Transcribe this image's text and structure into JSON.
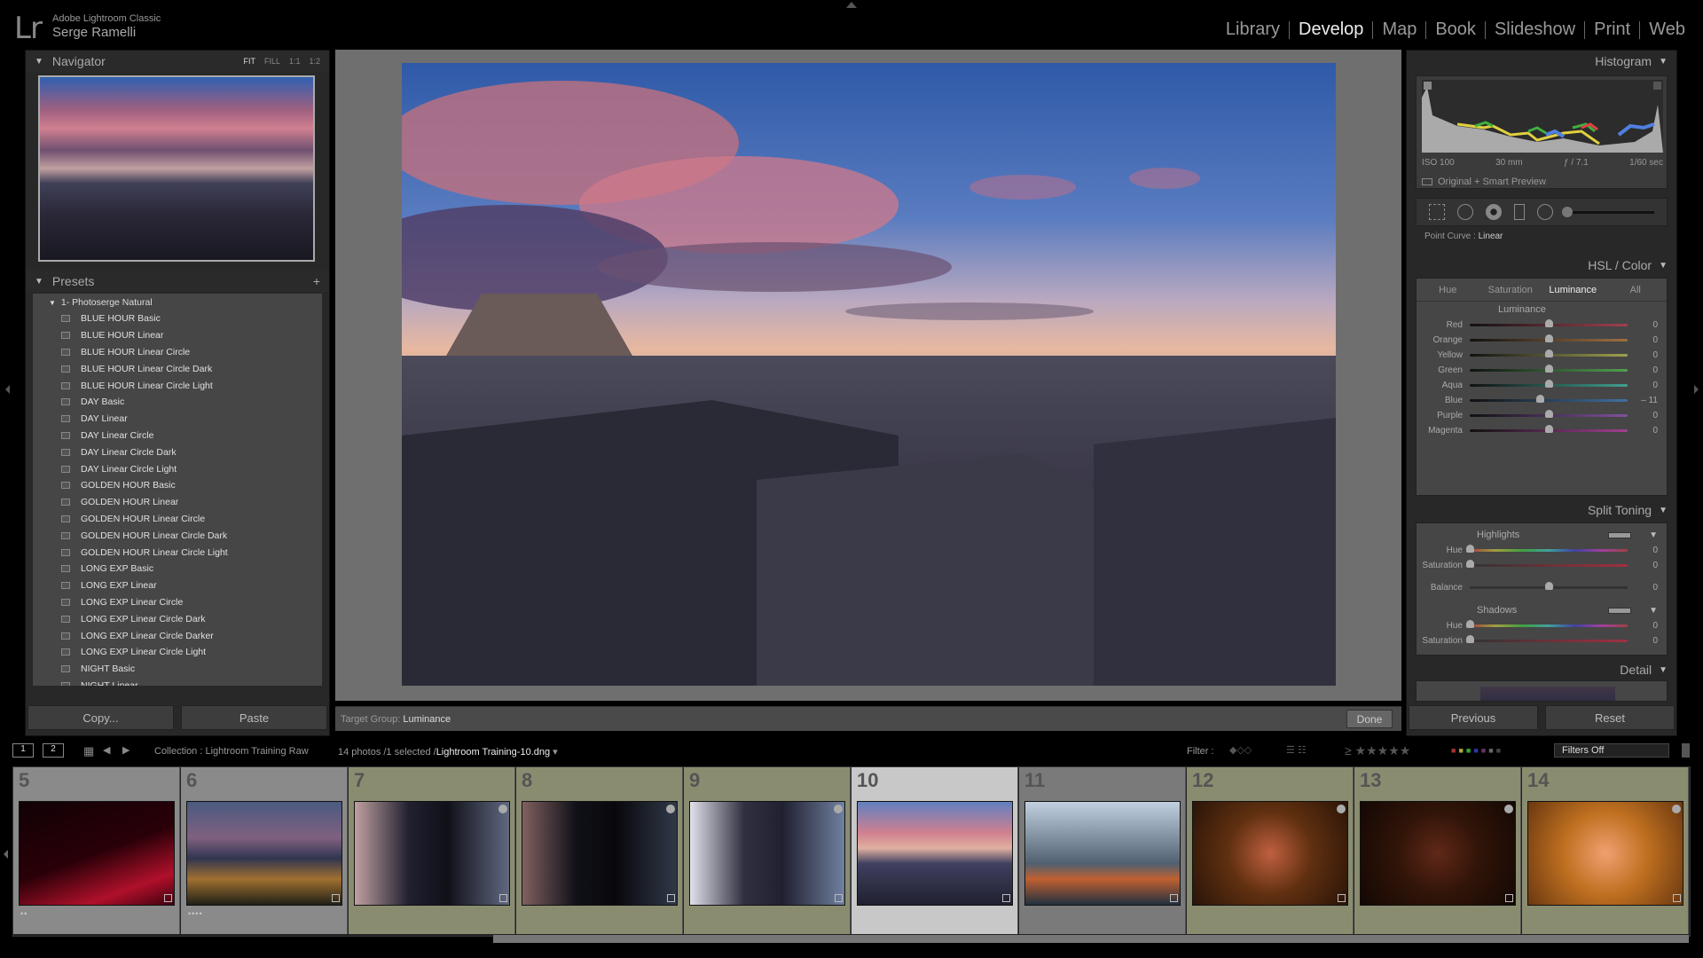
{
  "app": {
    "logo": "Lr",
    "name": "Adobe Lightroom Classic",
    "user": "Serge Ramelli"
  },
  "modules": [
    {
      "label": "Library",
      "active": false
    },
    {
      "label": "Develop",
      "active": true
    },
    {
      "label": "Map",
      "active": false
    },
    {
      "label": "Book",
      "active": false
    },
    {
      "label": "Slideshow",
      "active": false
    },
    {
      "label": "Print",
      "active": false
    },
    {
      "label": "Web",
      "active": false
    }
  ],
  "navigator": {
    "title": "Navigator",
    "zoom_options": [
      "FIT",
      "FILL",
      "1:1",
      "1:2"
    ],
    "selected_zoom": "FIT"
  },
  "presets": {
    "title": "Presets",
    "add_icon": "+",
    "folder": "1- Photoserge Natural",
    "items": [
      "BLUE HOUR Basic",
      "BLUE HOUR Linear",
      "BLUE HOUR Linear Circle",
      "BLUE HOUR Linear Circle Dark",
      "BLUE HOUR Linear Circle Light",
      "DAY Basic",
      "DAY Linear",
      "DAY Linear Circle",
      "DAY Linear Circle Dark",
      "DAY Linear Circle Light",
      "GOLDEN HOUR Basic",
      "GOLDEN HOUR Linear",
      "GOLDEN HOUR Linear Circle",
      "GOLDEN HOUR Linear Circle Dark",
      "GOLDEN HOUR Linear Circle Light",
      "LONG EXP Basic",
      "LONG EXP Linear",
      "LONG EXP Linear Circle",
      "LONG EXP Linear Circle Dark",
      "LONG EXP Linear Circle Darker",
      "LONG EXP Linear Circle Light",
      "NIGHT Basic",
      "NIGHT Linear"
    ]
  },
  "left_buttons": {
    "copy": "Copy...",
    "paste": "Paste"
  },
  "toolbar": {
    "target_label": "Target Group:",
    "target_value": "Luminance",
    "done": "Done"
  },
  "histogram": {
    "title": "Histogram",
    "iso": "ISO 100",
    "focal": "30 mm",
    "aperture": "ƒ / 7.1",
    "shutter": "1/60 sec",
    "preview_status": "Original + Smart Preview"
  },
  "point_curve": {
    "label": "Point Curve :",
    "value": "Linear"
  },
  "hsl": {
    "title": "HSL / Color",
    "tabs": [
      {
        "label": "Hue",
        "on": false
      },
      {
        "label": "Saturation",
        "on": false
      },
      {
        "label": "Luminance",
        "on": true
      },
      {
        "label": "All",
        "on": false
      }
    ],
    "group": "Luminance",
    "sliders": [
      {
        "label": "Red",
        "value": "0",
        "pos": 0,
        "color": "#a04050"
      },
      {
        "label": "Orange",
        "value": "0",
        "pos": 0,
        "color": "#a07040"
      },
      {
        "label": "Yellow",
        "value": "0",
        "pos": 0,
        "color": "#a0a050"
      },
      {
        "label": "Green",
        "value": "0",
        "pos": 0,
        "color": "#50a050"
      },
      {
        "label": "Aqua",
        "value": "0",
        "pos": 0,
        "color": "#40a090"
      },
      {
        "label": "Blue",
        "value": "– 11",
        "pos": -11,
        "color": "#4070a0"
      },
      {
        "label": "Purple",
        "value": "0",
        "pos": 0,
        "color": "#8050a0"
      },
      {
        "label": "Magenta",
        "value": "0",
        "pos": 0,
        "color": "#a04090"
      }
    ]
  },
  "split_toning": {
    "title": "Split Toning",
    "highlights": "Highlights",
    "shadows": "Shadows",
    "h_hue": {
      "label": "Hue",
      "value": "0"
    },
    "h_sat": {
      "label": "Saturation",
      "value": "0"
    },
    "balance": {
      "label": "Balance",
      "value": "0"
    },
    "s_hue": {
      "label": "Hue",
      "value": "0"
    },
    "s_sat": {
      "label": "Saturation",
      "value": "0"
    }
  },
  "detail": {
    "title": "Detail"
  },
  "right_buttons": {
    "previous": "Previous",
    "reset": "Reset"
  },
  "filmstrip_bar": {
    "view1": "1",
    "view2": "2",
    "collection": "Collection : Lightroom Training Raw",
    "count": "14 photos /1 selected /",
    "filename": "Lightroom Training-10.dng",
    "filter_label": "Filter :",
    "filters_value": "Filters Off"
  },
  "filmstrip": [
    {
      "num": "5",
      "bg": "#8a8a8a",
      "thumb": "linear-gradient(160deg,#100205 0%,#2a0008 50%,#b0102a 80%,#400010 100%)",
      "flag": false,
      "dots": "••"
    },
    {
      "num": "6",
      "bg": "#8a8a8a",
      "thumb": "linear-gradient(180deg,#4a5a80 0%,#806080 35%,#303550 55%,#a07030 75%,#202018 100%)",
      "flag": false,
      "dots": "••••"
    },
    {
      "num": "7",
      "bg": "#8a8c70",
      "thumb": "linear-gradient(90deg,#c0a0a0 0%,#202030 35%,#101018 60%,#606880 100%)",
      "flag": true,
      "dots": ""
    },
    {
      "num": "8",
      "bg": "#8a8c70",
      "thumb": "linear-gradient(90deg,#806060 0%,#101018 35%,#08080c 60%,#303848 100%)",
      "flag": true,
      "dots": ""
    },
    {
      "num": "9",
      "bg": "#8a8c70",
      "thumb": "linear-gradient(90deg,#e0e0ea 0%,#303040 35%,#202030 60%,#7080a0 100%)",
      "flag": true,
      "dots": ""
    },
    {
      "num": "10",
      "bg": "#c8c8c8",
      "thumb": "linear-gradient(180deg,#6080c0 0%,#d08090 30%,#e0b0a0 45%,#404060 60%,#202030 100%)",
      "flag": false,
      "dots": "",
      "selected": true
    },
    {
      "num": "11",
      "bg": "#7a7a7a",
      "thumb": "linear-gradient(180deg,#c0d0e0 0%,#8090a0 35%,#506070 60%,#c06030 75%,#203040 100%)",
      "flag": false,
      "dots": ""
    },
    {
      "num": "12",
      "bg": "#8a8c70",
      "thumb": "radial-gradient(circle at 50% 50%,#c06040 0%,#603010 45%,#2a1408 100%)",
      "flag": true,
      "dots": ""
    },
    {
      "num": "13",
      "bg": "#8a8c70",
      "thumb": "radial-gradient(circle at 50% 50%,#602818 0%,#301408 45%,#140804 100%)",
      "flag": true,
      "dots": ""
    },
    {
      "num": "14",
      "bg": "#8a8c70",
      "thumb": "radial-gradient(circle at 50% 50%,#f0a070 0%,#c07020 45%,#6a3810 100%)",
      "flag": true,
      "dots": ""
    }
  ]
}
